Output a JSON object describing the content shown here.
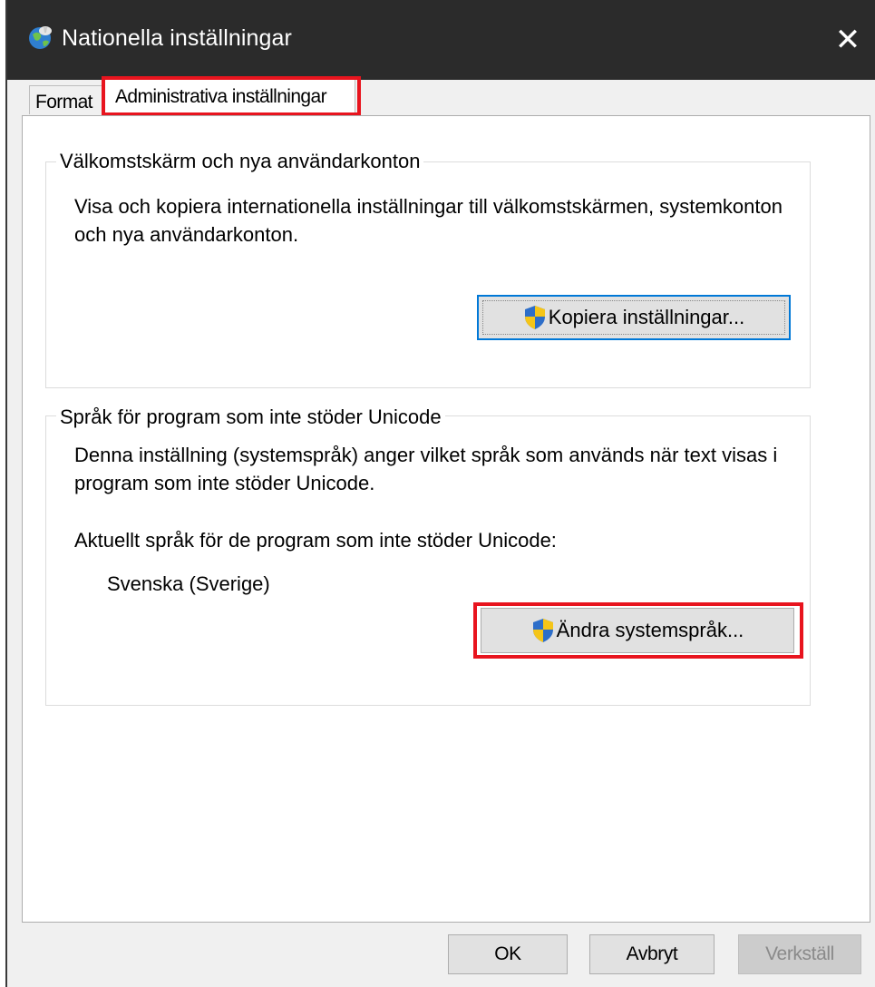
{
  "window": {
    "title": "Nationella inställningar",
    "close_glyph": "✕",
    "app_icon": "globe-icon"
  },
  "tabs": [
    {
      "label": "Format",
      "active": false
    },
    {
      "label": "Administrativa inställningar",
      "active": true
    }
  ],
  "welcome_group": {
    "legend": "Välkomstskärm och nya användarkonton",
    "description": "Visa och kopiera internationella inställningar till välkomstskärmen, systemkonton och nya användarkonton.",
    "copy_button": "Kopiera inställningar..."
  },
  "unicode_group": {
    "legend": "Språk för program som inte stöder Unicode",
    "description": "Denna inställning (systemspråk) anger vilket språk som används när text visas i program som inte stöder Unicode.",
    "current_label": "Aktuellt språk för de program som inte stöder Unicode:",
    "current_value": "Svenska (Sverige)",
    "change_button": "Ändra systemspråk..."
  },
  "footer": {
    "ok": "OK",
    "cancel": "Avbryt",
    "apply": "Verkställ"
  },
  "colors": {
    "highlight": "#e8141e",
    "titlebar": "#2b2b2b",
    "focus": "#0078d7"
  }
}
